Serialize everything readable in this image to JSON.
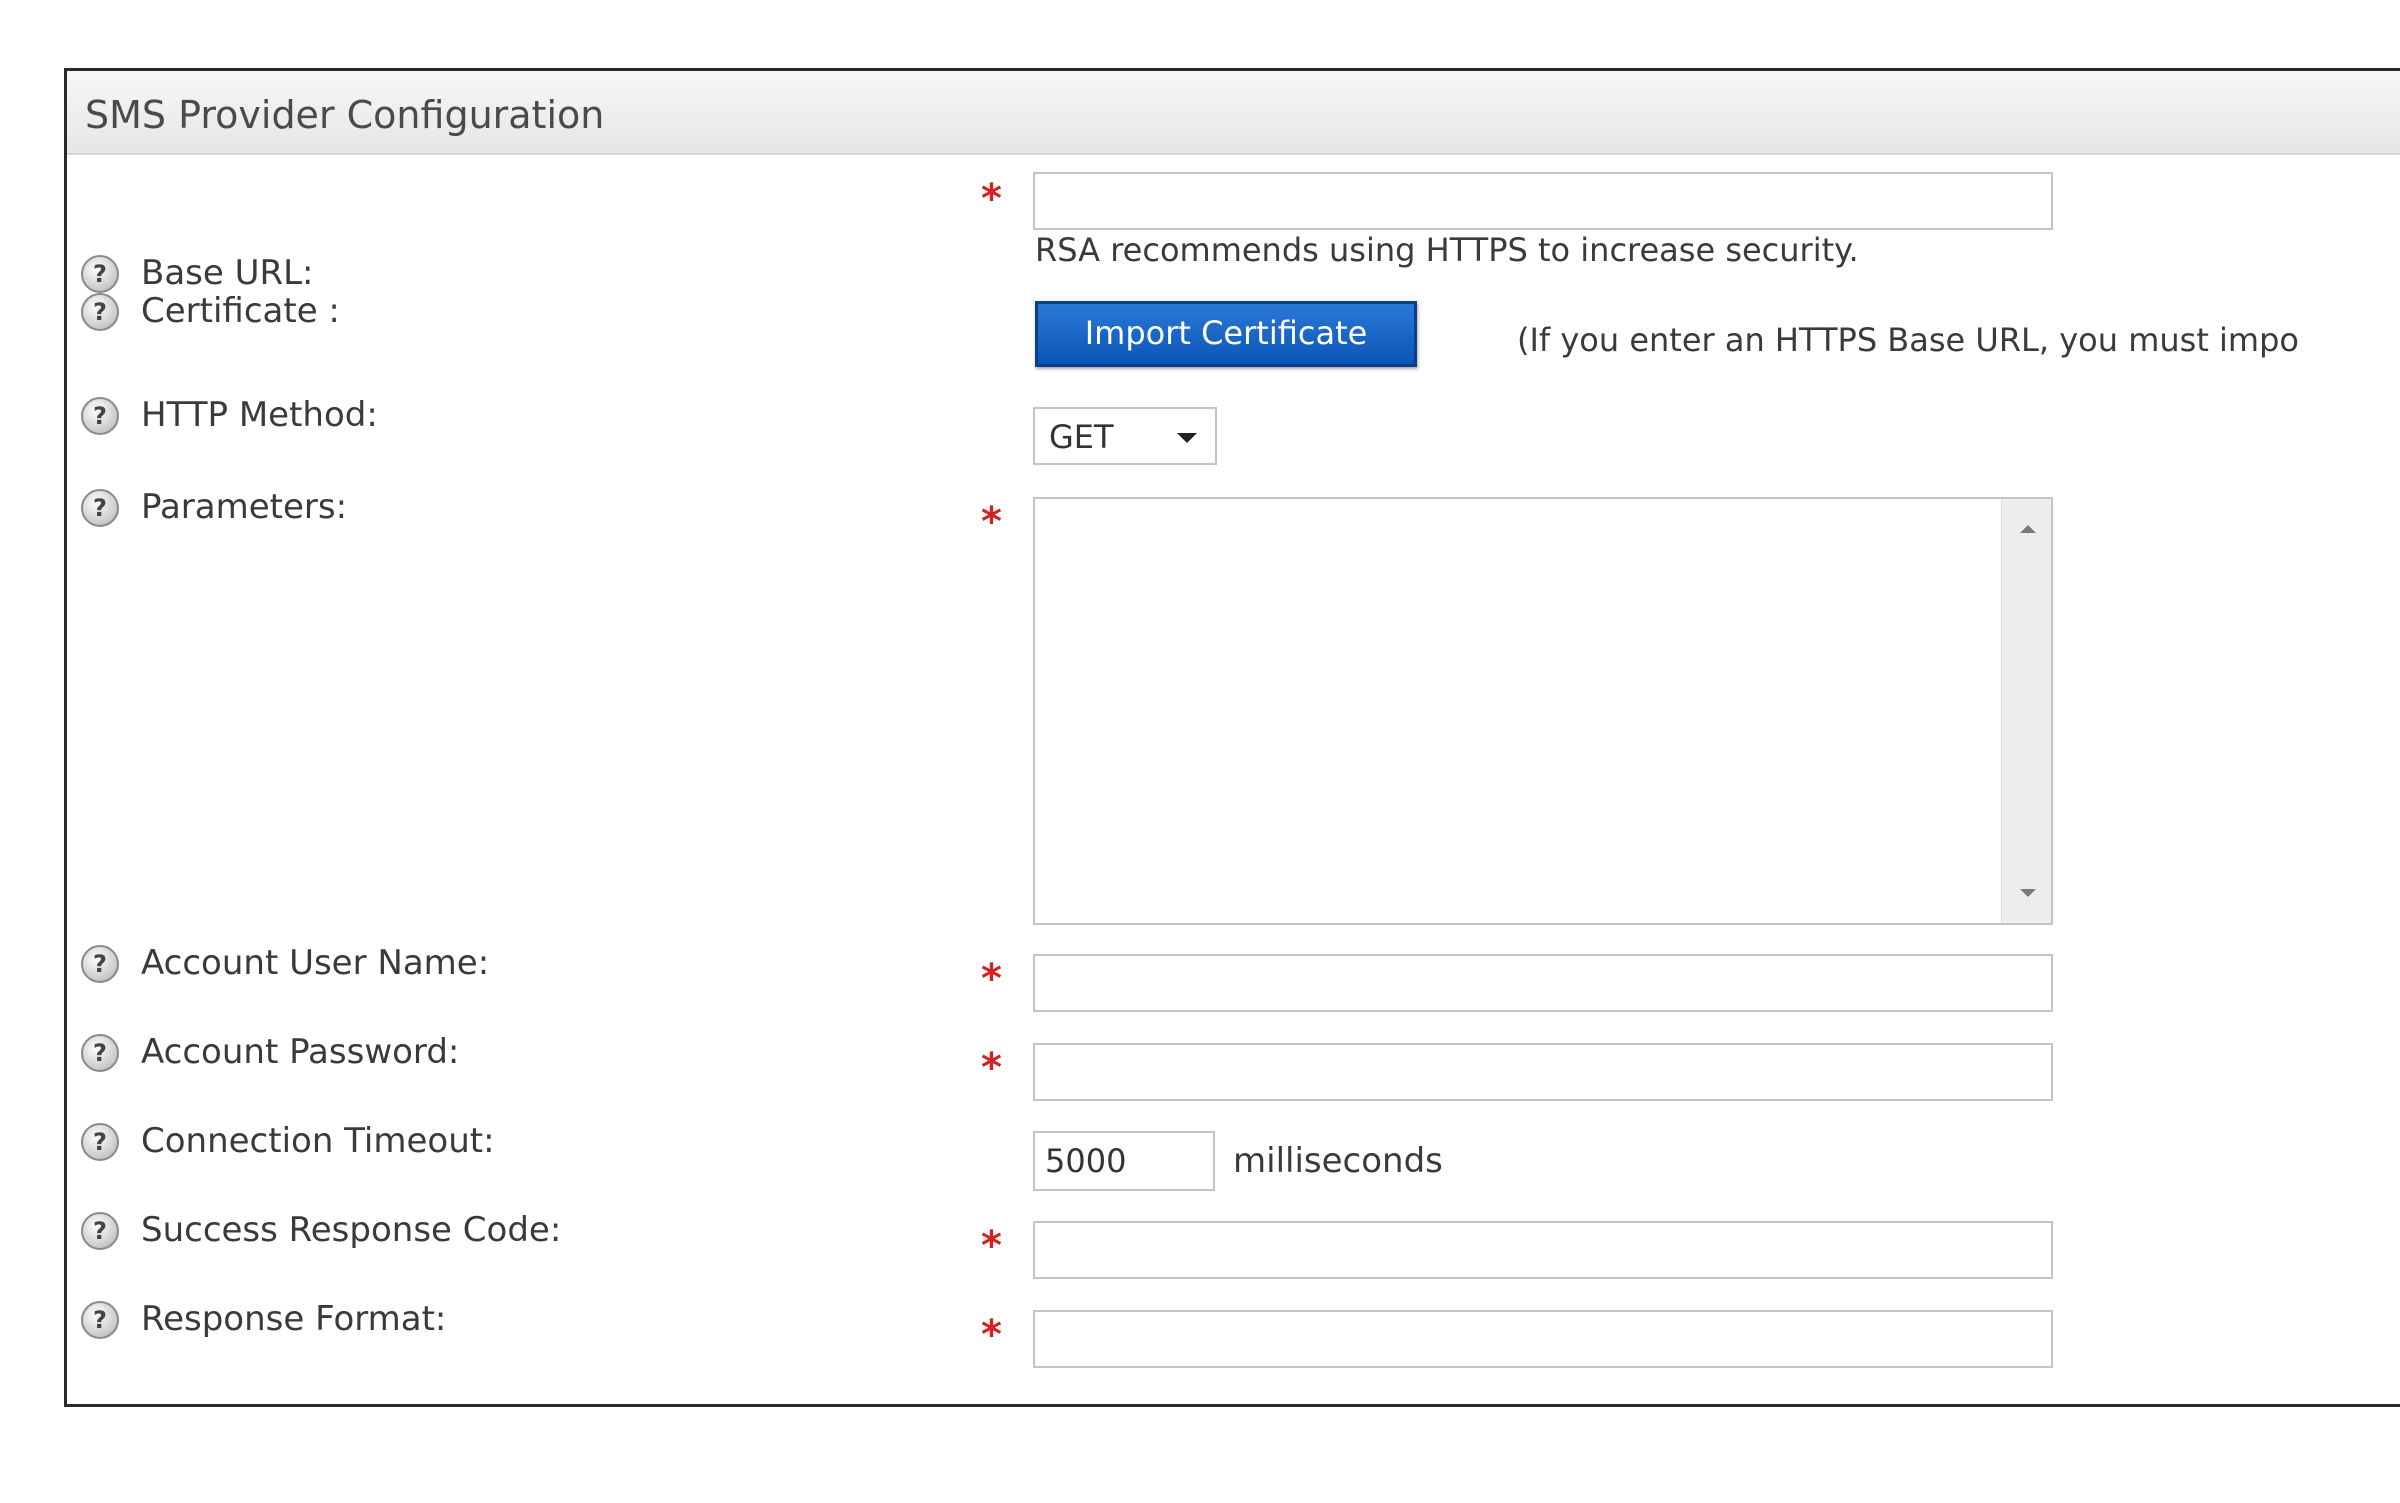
{
  "panel": {
    "title": "SMS Provider Configuration"
  },
  "help_glyph": "?",
  "required_marker": "*",
  "fields": {
    "base_url": {
      "label": "Base URL:",
      "value": "",
      "hint": "RSA recommends using HTTPS to increase security."
    },
    "certificate": {
      "label": "Certificate :",
      "button_label": "Import Certificate",
      "note": "(If you enter an HTTPS Base URL, you must impo"
    },
    "http_method": {
      "label": "HTTP Method:",
      "selected": "GET"
    },
    "parameters": {
      "label": "Parameters:",
      "value": ""
    },
    "account_user_name": {
      "label": "Account User Name:",
      "value": ""
    },
    "account_password": {
      "label": "Account Password:",
      "value": ""
    },
    "connection_timeout": {
      "label": "Connection Timeout:",
      "value": "5000",
      "unit": "milliseconds"
    },
    "success_response_code": {
      "label": "Success Response Code:",
      "value": ""
    },
    "response_format": {
      "label": "Response Format:",
      "value": ""
    }
  },
  "icons": {
    "help": "help-icon",
    "dropdown": "chevron-down-icon",
    "scroll_up": "scroll-up-arrow-icon",
    "scroll_down": "scroll-down-arrow-icon"
  },
  "colors": {
    "required": "#d61f1f",
    "button": "#0b56b8",
    "panel_border": "#2a2a2a"
  }
}
